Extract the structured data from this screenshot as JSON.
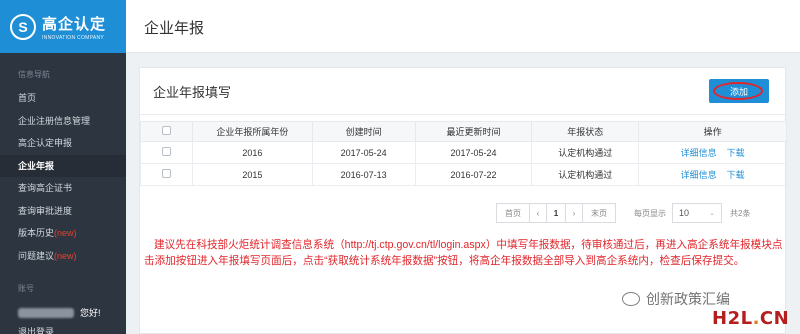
{
  "sidebar": {
    "logo": {
      "title": "高企认定",
      "subtitle": "INNOVATION COMPANY",
      "mark": "S"
    },
    "section_label": "信息导航",
    "items": [
      {
        "label": "首页"
      },
      {
        "label": "企业注册信息管理"
      },
      {
        "label": "高企认定申报"
      },
      {
        "label": "企业年报",
        "active": true
      },
      {
        "label": "查询高企证书"
      },
      {
        "label": "查询审批进度"
      },
      {
        "label": "版本历史",
        "badge": "(new)"
      },
      {
        "label": "问题建议",
        "badge": "(new)"
      }
    ],
    "account_label": "账号",
    "greeting": "您好!",
    "logout": "退出登录"
  },
  "header": {
    "title": "企业年报"
  },
  "panel": {
    "title": "企业年报填写",
    "add_button": "添加",
    "columns": [
      "企业年报所属年份",
      "创建时间",
      "最近更新时间",
      "年报状态",
      "操作"
    ],
    "rows": [
      {
        "year": "2016",
        "created": "2017-05-24",
        "updated": "2017-05-24",
        "status": "认定机构通过",
        "op1": "详细信息",
        "op2": "下载"
      },
      {
        "year": "2015",
        "created": "2016-07-13",
        "updated": "2016-07-22",
        "status": "认定机构通过",
        "op1": "详细信息",
        "op2": "下载"
      }
    ],
    "pager": {
      "first": "首页",
      "prev": "‹",
      "current": "1",
      "next": "›",
      "last": "末页",
      "page_size_label": "每页显示",
      "page_size": "10",
      "total": "共2条"
    },
    "notice": "建议先在科技部火炬统计调查信息系统（http://tj.ctp.gov.cn/tl/login.aspx）中填写年报数据，待审核通过后，再进入高企系统年报模块点击添加按钮进入年报填写页面后，点击“获取统计系统年报数据”按钮，将高企年报数据全部导入到高企系统内，检查后保存提交。"
  },
  "watermark": {
    "text": "创新政策汇编",
    "site": "H2L",
    "site_dot": ".",
    "site_tld": "CN"
  },
  "colors": {
    "brand": "#1e8fd6",
    "sidebar_bg": "#2d3540",
    "notice_red": "#e0262c"
  }
}
